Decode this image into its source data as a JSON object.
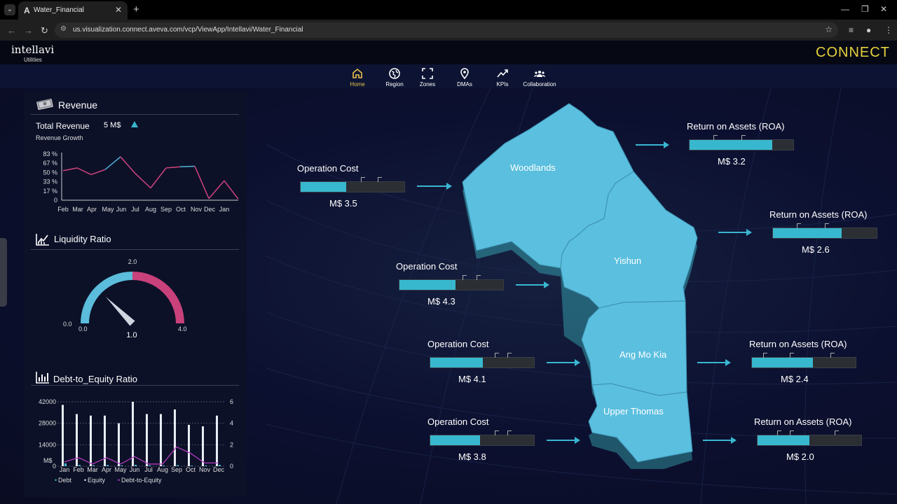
{
  "browser": {
    "tab_title": "Water_Financial",
    "url": "us.visualization.connect.aveva.com/vcp/ViewApp/Intellavi/Water_Financial"
  },
  "app": {
    "brand": "intellavi",
    "brand_sub": "Utilities",
    "logo": "CONNECT"
  },
  "nav": [
    {
      "label": "Home",
      "icon": "home-icon",
      "active": true
    },
    {
      "label": "Region",
      "icon": "globe-icon"
    },
    {
      "label": "Zones",
      "icon": "frame-icon"
    },
    {
      "label": "DMAs",
      "icon": "map-pin-icon"
    },
    {
      "label": "KPIs",
      "icon": "trend-icon"
    },
    {
      "label": "Collaboration",
      "icon": "people-icon"
    }
  ],
  "revenue": {
    "title": "Revenue",
    "total_label": "Total Revenue",
    "total_value": "5 M$",
    "growth_label": "Revenue Growth",
    "chart_data": {
      "type": "line",
      "categories": [
        "Feb",
        "Mar",
        "Apr",
        "May",
        "Jun",
        "Jul",
        "Aug",
        "Sep",
        "Oct",
        "Nov",
        "Dec",
        "Jan"
      ],
      "y_ticks": [
        "83 %",
        "67 %",
        "50 %",
        "33 %",
        "17 %",
        "0"
      ],
      "ylim": [
        0,
        83
      ],
      "values": [
        53,
        58,
        46,
        55,
        78,
        48,
        22,
        58,
        60,
        61,
        3,
        35,
        2
      ],
      "x_positions_note": ""
    }
  },
  "liquidity": {
    "title": "Liquidity Ratio",
    "chart_data": {
      "type": "gauge",
      "min": 0.0,
      "max": 4.0,
      "mid_label": "2.0",
      "value": 1.0,
      "outer_min_label": "0.0",
      "inner_min_label": "0.0",
      "max_label": "4.0",
      "value_label": "1.0"
    }
  },
  "debt": {
    "title": "Debt-to_Equity Ratio",
    "chart_data": {
      "type": "bar",
      "categories": [
        "Jan",
        "Feb",
        "Mar",
        "Apr",
        "May",
        "Jun",
        "Jul",
        "Aug",
        "Sep",
        "Oct",
        "Nov",
        "Dec"
      ],
      "y_ticks": [
        "42000",
        "28000",
        "14000",
        "0"
      ],
      "y2_ticks": [
        "6",
        "4",
        "2",
        "0"
      ],
      "y_unit": "M$",
      "ylim": [
        0,
        42000
      ],
      "y2lim": [
        0,
        6
      ],
      "series": [
        {
          "name": "Debt",
          "values": [
            40000,
            34000,
            33000,
            33000,
            28000,
            42000,
            34000,
            34000,
            37000,
            27000,
            26000,
            33000
          ]
        },
        {
          "name": "Equity",
          "values": [
            1800,
            800,
            600,
            800,
            500,
            900,
            600,
            500,
            700,
            400,
            500,
            900
          ]
        },
        {
          "name": "Debt-to-Equity",
          "values": [
            0.4,
            0.8,
            0.2,
            0.8,
            0.2,
            0.9,
            0.2,
            0.2,
            1.8,
            1.2,
            0.3,
            0.3
          ]
        }
      ]
    }
  },
  "map": {
    "regions": [
      {
        "name": "Woodlands"
      },
      {
        "name": "Yishun"
      },
      {
        "name": "Ang Mo Kia"
      },
      {
        "name": "Upper Thomas"
      }
    ],
    "cost_label": "Operation Cost",
    "roa_label": "Return on Assets (ROA)",
    "costs": [
      {
        "value": "M$  3.5",
        "fill": 0.44
      },
      {
        "value": "M$  4.3",
        "fill": 0.54
      },
      {
        "value": "M$  4.1",
        "fill": 0.51
      },
      {
        "value": "M$  3.8",
        "fill": 0.48
      }
    ],
    "roas": [
      {
        "value": "M$  3.2",
        "fill": 0.8
      },
      {
        "value": "M$  2.6",
        "fill": 0.66
      },
      {
        "value": "M$  2.4",
        "fill": 0.59
      },
      {
        "value": "M$  2.0",
        "fill": 0.5
      }
    ]
  }
}
